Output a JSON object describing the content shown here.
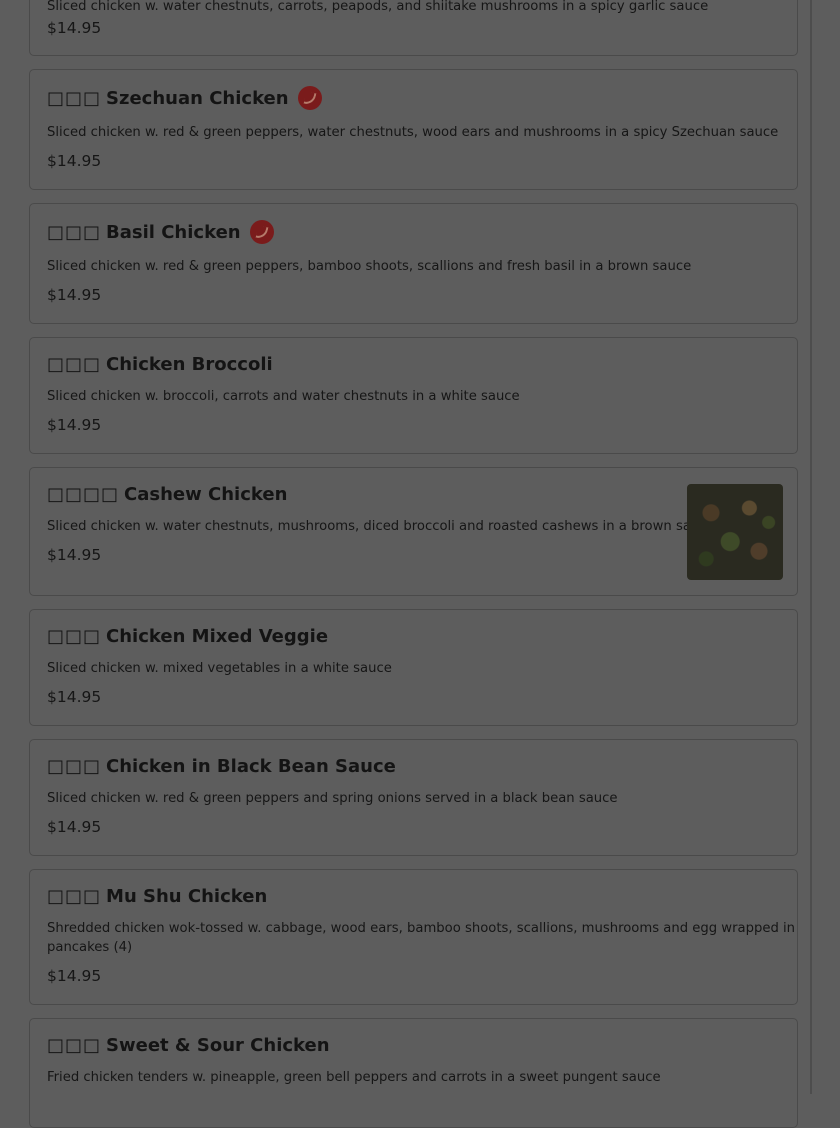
{
  "menu_items": [
    {
      "chinese": "",
      "name": "",
      "description": "Sliced chicken w. water chestnuts, carrots, peapods, and shiitake mushrooms in a spicy garlic sauce",
      "price": "$14.95",
      "spicy": false
    },
    {
      "chinese": "□□□",
      "name": "Szechuan Chicken",
      "description": "Sliced chicken w. red & green peppers, water chestnuts, wood ears and mushrooms in a spicy Szechuan sauce",
      "price": "$14.95",
      "spicy": true
    },
    {
      "chinese": "□□□",
      "name": "Basil Chicken",
      "description": "Sliced chicken w. red & green peppers, bamboo shoots, scallions and fresh basil in a brown sauce",
      "price": "$14.95",
      "spicy": true
    },
    {
      "chinese": "□□□",
      "name": "Chicken Broccoli",
      "description": "Sliced chicken w. broccoli, carrots and water chestnuts in a white sauce",
      "price": "$14.95",
      "spicy": false
    },
    {
      "chinese": "□□□□",
      "name": "Cashew Chicken",
      "description": "Sliced chicken w. water chestnuts, mushrooms, diced broccoli and roasted cashews in a brown sauce",
      "price": "$14.95",
      "spicy": false,
      "has_image": true
    },
    {
      "chinese": "□□□",
      "name": "Chicken Mixed Veggie",
      "description": "Sliced chicken w. mixed vegetables in a white sauce",
      "price": "$14.95",
      "spicy": false
    },
    {
      "chinese": "□□□",
      "name": "Chicken in Black Bean Sauce",
      "description": "Sliced chicken w. red & green peppers and spring onions served in a black bean sauce",
      "price": "$14.95",
      "spicy": false
    },
    {
      "chinese": "□□□",
      "name": "Mu Shu Chicken",
      "description_line1": "Shredded chicken wok-tossed w. cabbage, wood ears, bamboo shoots, scallions, mushrooms and egg wrapped in",
      "description_line2": "pancakes (4)",
      "price": "$14.95",
      "spicy": false
    },
    {
      "chinese": "□□□",
      "name": "Sweet & Sour Chicken",
      "description": "Fried chicken tenders w. pineapple, green bell peppers and carrots in a sweet pungent sauce",
      "price": "",
      "spicy": false
    }
  ],
  "colors": {
    "overlay_bg": "#5d5d5d",
    "text": "#161616",
    "spicy_badge": "#7a1b1b"
  },
  "icons": {
    "spicy": "chili-pepper-icon"
  }
}
